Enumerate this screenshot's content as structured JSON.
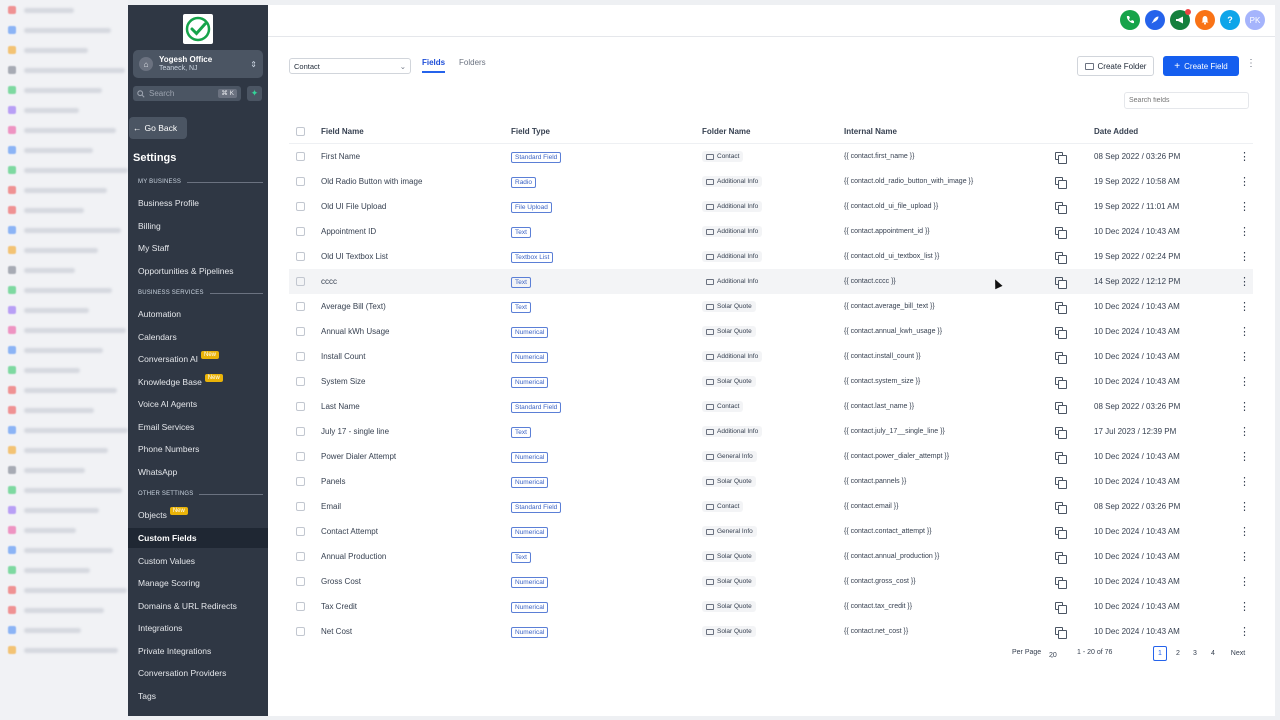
{
  "app": {
    "location_name": "Yogesh Office",
    "location_city": "Teaneck, NJ",
    "search_placeholder": "Search",
    "search_shortcut": "⌘ K",
    "go_back": "Go Back",
    "settings_title": "Settings"
  },
  "sidebar": {
    "sections": {
      "my_business": "MY BUSINESS",
      "business_services": "BUSINESS SERVICES",
      "other_settings": "OTHER SETTINGS"
    },
    "items": [
      {
        "label": "Business Profile"
      },
      {
        "label": "Billing"
      },
      {
        "label": "My Staff"
      },
      {
        "label": "Opportunities & Pipelines"
      },
      {
        "label": "Automation"
      },
      {
        "label": "Calendars"
      },
      {
        "label": "Conversation AI",
        "badge": "New"
      },
      {
        "label": "Knowledge Base",
        "badge": "New"
      },
      {
        "label": "Voice AI Agents"
      },
      {
        "label": "Email Services"
      },
      {
        "label": "Phone Numbers"
      },
      {
        "label": "WhatsApp"
      },
      {
        "label": "Objects",
        "badge": "New"
      },
      {
        "label": "Custom Fields",
        "active": true
      },
      {
        "label": "Custom Values"
      },
      {
        "label": "Manage Scoring"
      },
      {
        "label": "Domains & URL Redirects"
      },
      {
        "label": "Integrations"
      },
      {
        "label": "Private Integrations"
      },
      {
        "label": "Conversation Providers"
      },
      {
        "label": "Tags"
      }
    ]
  },
  "topbar": {
    "avatar_initials": "PK",
    "icons": [
      {
        "name": "phone-icon",
        "color": "#16a34a"
      },
      {
        "name": "rocket-icon",
        "color": "#2563eb"
      },
      {
        "name": "megaphone-icon",
        "color": "#15803d"
      },
      {
        "name": "bell-icon",
        "color": "#f97316"
      },
      {
        "name": "help-icon",
        "color": "#0ea5e9"
      }
    ],
    "help_glyph": "?"
  },
  "toolbar": {
    "object_select": "Contact",
    "tabs": [
      "Fields",
      "Folders"
    ],
    "create_folder": "Create Folder",
    "create_field": "Create Field",
    "search_fields_placeholder": "Search fields"
  },
  "table": {
    "headers": [
      "Field Name",
      "Field Type",
      "Folder Name",
      "Internal Name",
      "Date Added"
    ],
    "rows": [
      {
        "name": "First Name",
        "type": "Standard Field",
        "folder": "Contact",
        "internal": "{{ contact.first_name }}",
        "date": "08 Sep 2022 / 03:26 PM"
      },
      {
        "name": "Old Radio Button with image",
        "type": "Radio",
        "folder": "Additional Info",
        "internal": "{{ contact.old_radio_button_with_image }}",
        "date": "19 Sep 2022 / 10:58 AM"
      },
      {
        "name": "Old UI File Upload",
        "type": "File Upload",
        "folder": "Additional Info",
        "internal": "{{ contact.old_ui_file_upload }}",
        "date": "19 Sep 2022 / 11:01 AM"
      },
      {
        "name": "Appointment ID",
        "type": "Text",
        "folder": "Additional Info",
        "internal": "{{ contact.appointment_id }}",
        "date": "10 Dec 2024 / 10:43 AM"
      },
      {
        "name": "Old UI Textbox List",
        "type": "Textbox List",
        "folder": "Additional Info",
        "internal": "{{ contact.old_ui_textbox_list }}",
        "date": "19 Sep 2022 / 02:24 PM"
      },
      {
        "name": "cccc",
        "type": "Text",
        "folder": "Additional Info",
        "internal": "{{ contact.cccc }}",
        "date": "14 Sep 2022 / 12:12 PM"
      },
      {
        "name": "Average Bill (Text)",
        "type": "Text",
        "folder": "Solar Quote",
        "internal": "{{ contact.average_bill_text }}",
        "date": "10 Dec 2024 / 10:43 AM"
      },
      {
        "name": "Annual kWh Usage",
        "type": "Numerical",
        "folder": "Solar Quote",
        "internal": "{{ contact.annual_kwh_usage }}",
        "date": "10 Dec 2024 / 10:43 AM"
      },
      {
        "name": "Install Count",
        "type": "Numerical",
        "folder": "Additional Info",
        "internal": "{{ contact.install_count }}",
        "date": "10 Dec 2024 / 10:43 AM"
      },
      {
        "name": "System Size",
        "type": "Numerical",
        "folder": "Solar Quote",
        "internal": "{{ contact.system_size }}",
        "date": "10 Dec 2024 / 10:43 AM"
      },
      {
        "name": "Last Name",
        "type": "Standard Field",
        "folder": "Contact",
        "internal": "{{ contact.last_name }}",
        "date": "08 Sep 2022 / 03:26 PM"
      },
      {
        "name": "July 17 - single line",
        "type": "Text",
        "folder": "Additional Info",
        "internal": "{{ contact.july_17__single_line }}",
        "date": "17 Jul 2023 / 12:39 PM"
      },
      {
        "name": "Power Dialer Attempt",
        "type": "Numerical",
        "folder": "General Info",
        "internal": "{{ contact.power_dialer_attempt }}",
        "date": "10 Dec 2024 / 10:43 AM"
      },
      {
        "name": "Panels",
        "type": "Numerical",
        "folder": "Solar Quote",
        "internal": "{{ contact.pannels }}",
        "date": "10 Dec 2024 / 10:43 AM"
      },
      {
        "name": "Email",
        "type": "Standard Field",
        "folder": "Contact",
        "internal": "{{ contact.email }}",
        "date": "08 Sep 2022 / 03:26 PM"
      },
      {
        "name": "Contact Attempt",
        "type": "Numerical",
        "folder": "General Info",
        "internal": "{{ contact.contact_attempt }}",
        "date": "10 Dec 2024 / 10:43 AM"
      },
      {
        "name": "Annual Production",
        "type": "Text",
        "folder": "Solar Quote",
        "internal": "{{ contact.annual_production }}",
        "date": "10 Dec 2024 / 10:43 AM"
      },
      {
        "name": "Gross Cost",
        "type": "Numerical",
        "folder": "Solar Quote",
        "internal": "{{ contact.gross_cost }}",
        "date": "10 Dec 2024 / 10:43 AM"
      },
      {
        "name": "Tax Credit",
        "type": "Numerical",
        "folder": "Solar Quote",
        "internal": "{{ contact.tax_credit }}",
        "date": "10 Dec 2024 / 10:43 AM"
      },
      {
        "name": "Net Cost",
        "type": "Numerical",
        "folder": "Solar Quote",
        "internal": "{{ contact.net_cost }}",
        "date": "10 Dec 2024 / 10:43 AM"
      }
    ]
  },
  "pagination": {
    "per_page_label": "Per Page",
    "per_page_value": "20",
    "range": "1 - 20 of 76",
    "pages": [
      "1",
      "2",
      "3",
      "4"
    ],
    "next": "Next"
  },
  "colors": {
    "primary": "#155eef",
    "sidebar_bg": "#2f3744",
    "new_badge": "#eab308"
  }
}
